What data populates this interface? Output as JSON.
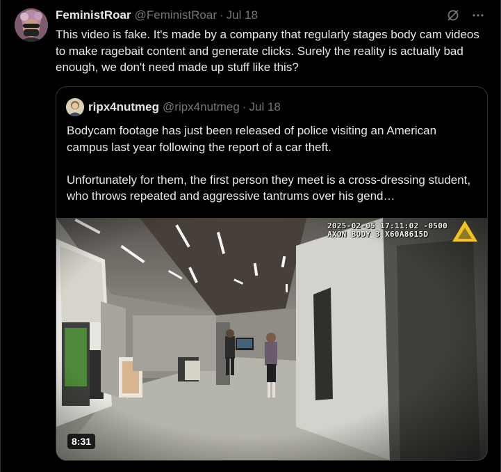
{
  "tweet": {
    "author_name": "FeministRoar",
    "author_handle": "@FeministRoar",
    "separator": "·",
    "date": "Jul 18",
    "text": "This video is fake. It's made by a company that regularly stages body cam videos to make ragebait content and generate clicks.  Surely the reality is actually bad enough, we don't need made up stuff like this?"
  },
  "icons": {
    "grok": "grok-icon",
    "more": "more-icon"
  },
  "quote": {
    "author_name": "ripx4nutmeg",
    "author_handle": "@ripx4nutmeg",
    "separator": "·",
    "date": "Jul 18",
    "text": "Bodycam footage has just been released of police visiting an American campus last year following the report of a car theft.\n\nUnfortunately for them, the first person they meet is a cross-dressing student, who throws repeated and aggressive tantrums over his gend…",
    "video": {
      "timestamp_line1": "2025-02-05 17:11:02 -0500",
      "timestamp_line2": "AXON BODY 3 X60A8615D",
      "duration": "8:31"
    }
  },
  "colors": {
    "background": "#000000",
    "text": "#e7e9ea",
    "muted": "#71767b",
    "border": "#2f3336",
    "axon_yellow": "#f2c31c"
  }
}
